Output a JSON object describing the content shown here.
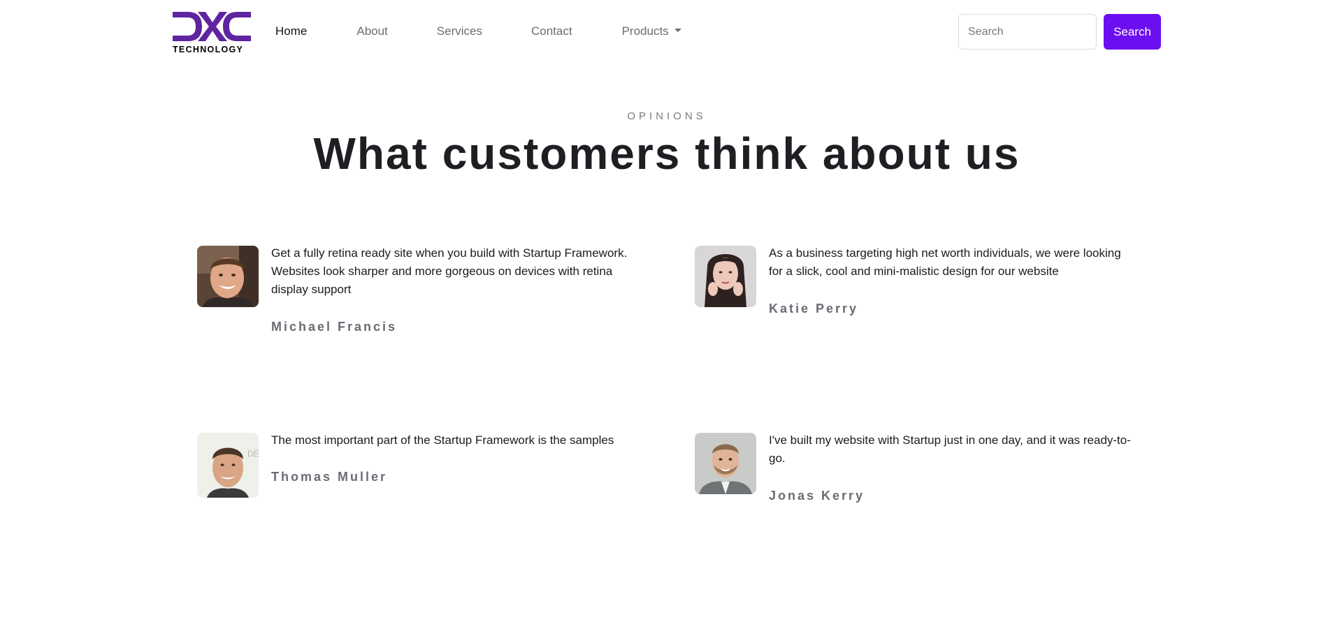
{
  "brand": {
    "logo_wordmark": "DXC",
    "logo_subtext": "TECHNOLOGY",
    "accent_color": "#6b0ff0",
    "logo_color": "#5f249f"
  },
  "nav": {
    "items": [
      {
        "label": "Home",
        "active": true
      },
      {
        "label": "About",
        "active": false
      },
      {
        "label": "Services",
        "active": false
      },
      {
        "label": "Contact",
        "active": false
      },
      {
        "label": "Products",
        "active": false,
        "dropdown": true
      }
    ],
    "search": {
      "placeholder": "Search",
      "value": "",
      "button_label": "Search"
    }
  },
  "section": {
    "eyebrow": "OPINIONS",
    "title": "What customers think about us"
  },
  "testimonials": [
    {
      "quote": "Get a fully retina ready site when you build with Startup Framework. Websites look sharper and more gorgeous on devices with retina display support",
      "author": "Michael Francis",
      "avatar_icon": "man-smiling-avatar"
    },
    {
      "quote": "As a business targeting high net worth individuals, we were looking for a slick, cool and mini-malistic design for our website",
      "author": "Katie Perry",
      "avatar_icon": "woman-dark-hair-avatar"
    },
    {
      "quote": "The most important part of the Startup Framework is the samples",
      "author": "Thomas Muller",
      "avatar_icon": "man-short-hair-avatar"
    },
    {
      "quote": "I've built my website with Startup just in one day, and it was ready-to-go.",
      "author": "Jonas Kerry",
      "avatar_icon": "man-beard-suit-avatar"
    }
  ]
}
